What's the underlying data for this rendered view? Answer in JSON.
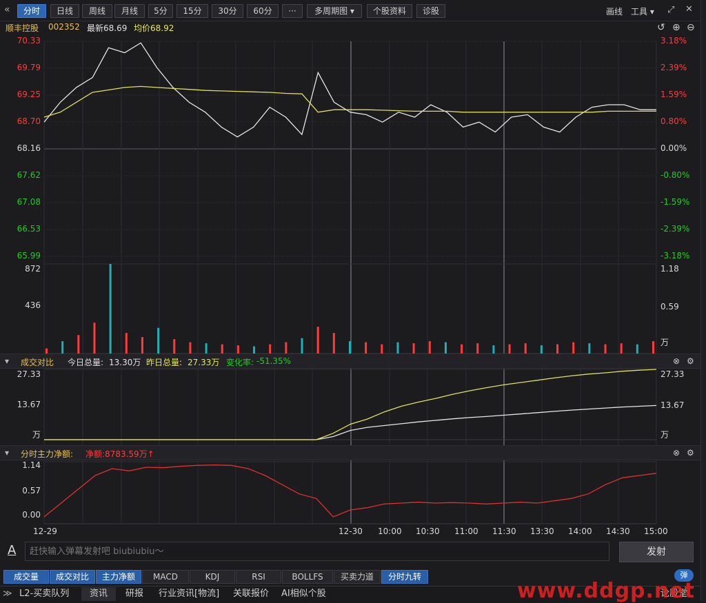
{
  "toolbar": {
    "collapse": "«",
    "tabs": [
      "分时",
      "日线",
      "周线",
      "月线",
      "5分",
      "15分",
      "30分",
      "60分",
      "···",
      "多周期图 ▾",
      "个股资料",
      "诊股"
    ],
    "active": "分时",
    "right": {
      "draw": "画线",
      "tools": "工具 ▾"
    }
  },
  "stock": {
    "name": "顺丰控股",
    "code": "002352",
    "latest": "最新68.69",
    "avg": "均价68.92"
  },
  "price_axis": {
    "left": [
      "70.33",
      "69.79",
      "69.25",
      "68.70",
      "68.16",
      "67.62",
      "67.08",
      "66.53",
      "65.99"
    ],
    "right": [
      "3.18%",
      "2.39%",
      "1.59%",
      "0.80%",
      "0.00%",
      "-0.80%",
      "-1.59%",
      "-2.39%",
      "-3.18%"
    ]
  },
  "volume_axis": {
    "left": [
      "872",
      "436"
    ],
    "right": [
      "1.18",
      "0.59",
      "万"
    ]
  },
  "compare": {
    "title": "成交对比",
    "today_label": "今日总量:",
    "today_value": "13.30万",
    "yesterday_label": "昨日总量:",
    "yesterday_value": "27.33万",
    "change_label": "变化率:",
    "change_value": "-51.35%",
    "axis_left": [
      "27.33",
      "13.67",
      "万"
    ],
    "axis_right": [
      "27.33",
      "13.67",
      "万"
    ]
  },
  "mainforce": {
    "title": "分时主力净额:",
    "net_label": "净额:8783.59万↑",
    "axis_left": [
      "1.14",
      "0.57",
      "0.00"
    ]
  },
  "time_axis": [
    "12-29",
    "12-30",
    "10:00",
    "10:30",
    "11:00",
    "11:30",
    "13:30",
    "14:00",
    "14:30",
    "15:00"
  ],
  "danmu": {
    "placeholder": "赶快输入弹幕发射吧 biubiubiu～",
    "send": "发射"
  },
  "indicators": [
    "成交量",
    "成交对比",
    "主力净额",
    "MACD",
    "KDJ",
    "RSI",
    "BOLLFS",
    "买卖力道",
    "分时九转"
  ],
  "indicators_on": [
    "成交量",
    "成交对比",
    "主力净额",
    "分时九转"
  ],
  "bottom_tabs": [
    "L2-买卖队列",
    "资讯",
    "研报",
    "行业资讯[物流]",
    "关联报价",
    "AI相似个股"
  ],
  "bottom_right": {
    "bullet": "弹",
    "forum": "论股堂"
  },
  "watermark": "www.ddgp.net",
  "colors": {
    "up": "#ff3b3b",
    "down": "#19d219",
    "price": "#e6e6e6",
    "avg": "#e0e05a",
    "bg": "#1c1c1f"
  },
  "chart_data": {
    "type": "line",
    "title": "",
    "x": [
      "12-29",
      "12-30",
      "10:00",
      "10:30",
      "11:00",
      "11:30",
      "13:30",
      "14:00",
      "14:30",
      "15:00"
    ],
    "ylim": [
      65.99,
      70.33
    ],
    "series": [
      {
        "name": "",
        "values": [
          68.7,
          69.1,
          69.4,
          69.6,
          70.2,
          70.1,
          70.3,
          69.8,
          69.4,
          69.1,
          68.9,
          68.6,
          68.4,
          68.6,
          69.0,
          68.8,
          68.45,
          69.7,
          69.1,
          68.9,
          68.85,
          68.7,
          68.9,
          68.8,
          69.05,
          68.9,
          68.6,
          68.7,
          68.5,
          68.8,
          68.85,
          68.6,
          68.5,
          68.8,
          69.0,
          69.05,
          69.05,
          68.95,
          68.95
        ]
      },
      {
        "name": "",
        "values": [
          68.8,
          68.9,
          69.1,
          69.3,
          69.35,
          69.4,
          69.42,
          69.4,
          69.38,
          69.36,
          69.34,
          69.33,
          69.32,
          69.31,
          69.3,
          69.28,
          69.27,
          68.9,
          68.95,
          68.95,
          68.95,
          68.94,
          68.93,
          68.92,
          68.92,
          68.92,
          68.9,
          68.9,
          68.9,
          68.9,
          68.9,
          68.9,
          68.9,
          68.9,
          68.9,
          68.92,
          68.92,
          68.92,
          68.92
        ]
      }
    ],
    "volume": [
      50,
      120,
      180,
      300,
      872,
      200,
      160,
      250,
      140,
      110,
      100,
      90,
      80,
      70,
      90,
      110,
      150,
      260,
      200,
      120,
      110,
      90,
      110,
      100,
      120,
      110,
      90,
      100,
      80,
      90,
      100,
      80,
      90,
      110,
      100,
      90,
      100,
      90,
      120
    ],
    "compare_series": [
      {
        "name": "今日总量",
        "values": [
          0,
          0,
          0,
          0,
          0,
          0,
          0,
          0,
          0,
          0,
          0,
          0,
          0,
          0,
          0,
          0,
          0,
          1.2,
          3.6,
          4.8,
          5.5,
          6.2,
          6.9,
          7.5,
          8.1,
          8.6,
          9.0,
          9.5,
          10.0,
          10.5,
          11.0,
          11.5,
          11.9,
          12.3,
          12.7,
          13.0,
          13.3
        ]
      },
      {
        "name": "昨日总量",
        "values": [
          0,
          0,
          0,
          0,
          0,
          0,
          0,
          0,
          0,
          0,
          0,
          0,
          0,
          0,
          0,
          0,
          0,
          2.5,
          6.0,
          8.0,
          10.8,
          13.0,
          14.6,
          16.0,
          17.6,
          19.0,
          20.2,
          21.3,
          22.2,
          23.1,
          24.0,
          24.8,
          25.5,
          26.0,
          26.6,
          27.0,
          27.33
        ]
      }
    ],
    "mainforce_values": [
      0.0,
      0.3,
      0.6,
      0.9,
      1.05,
      1.0,
      1.08,
      1.07,
      1.1,
      1.12,
      1.13,
      1.12,
      1.05,
      0.9,
      0.7,
      0.5,
      0.4,
      0.0,
      0.15,
      0.2,
      0.28,
      0.3,
      0.32,
      0.3,
      0.31,
      0.3,
      0.28,
      0.3,
      0.32,
      0.3,
      0.35,
      0.4,
      0.5,
      0.7,
      0.85,
      0.9,
      0.95
    ]
  }
}
